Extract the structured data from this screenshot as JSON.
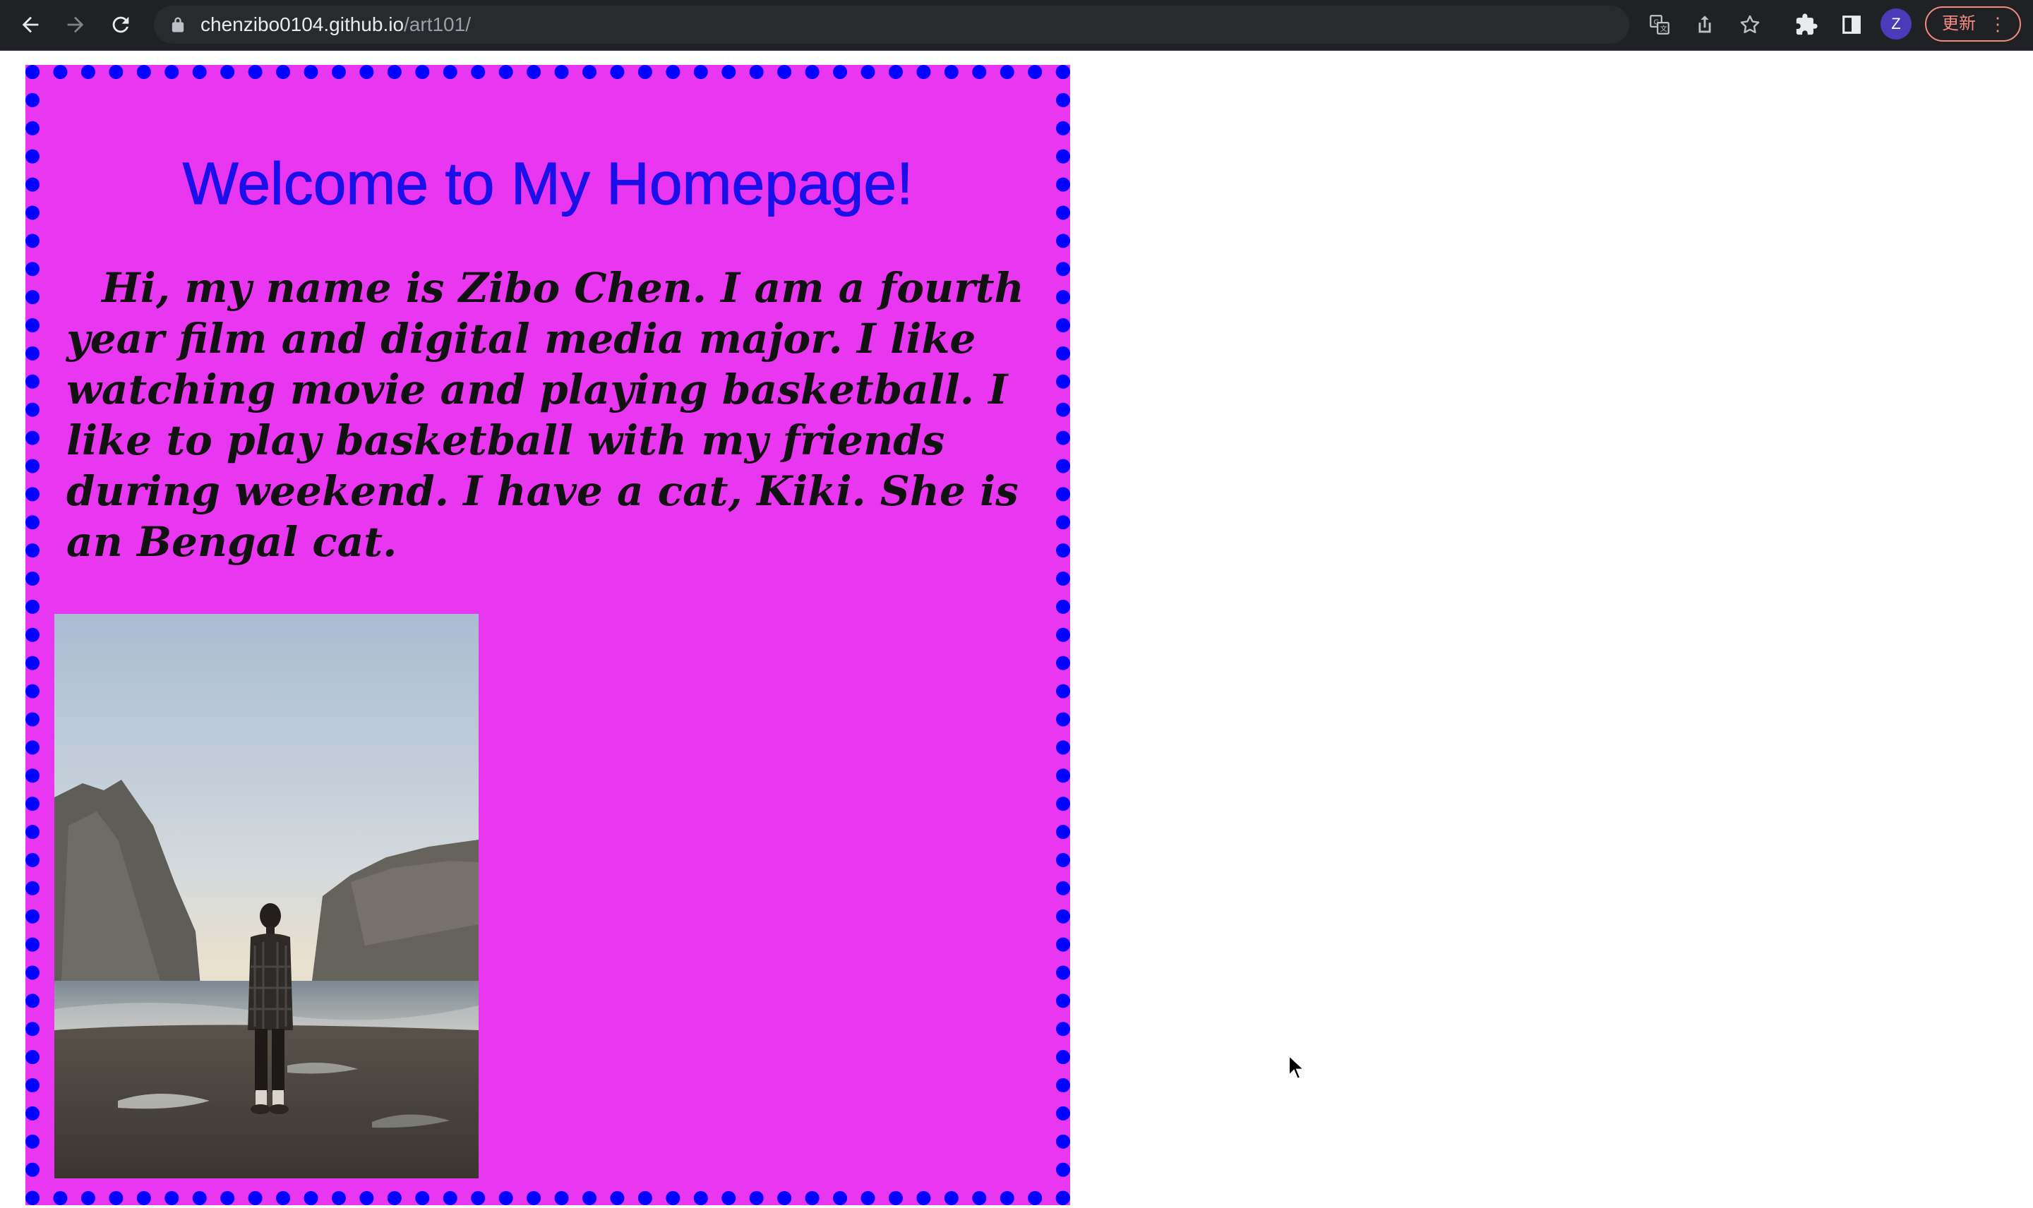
{
  "browser": {
    "url_host": "chenzibo0104.github.io",
    "url_path": "/art101/",
    "profile_initial": "Z",
    "update_label": "更新",
    "menu_label": "⋮"
  },
  "page": {
    "title": "Welcome to My Homepage!",
    "bio": "Hi, my name is Zibo Chen. I am a fourth year film and digital media major. I like watching movie and playing basketball. I like to play basketball with my friends during weekend. I have a cat, Kiki. She is an Bengal cat.",
    "colors": {
      "background": "#e936f0",
      "border": "#0000ff",
      "title": "#1a0fe8",
      "text": "#111111"
    }
  }
}
